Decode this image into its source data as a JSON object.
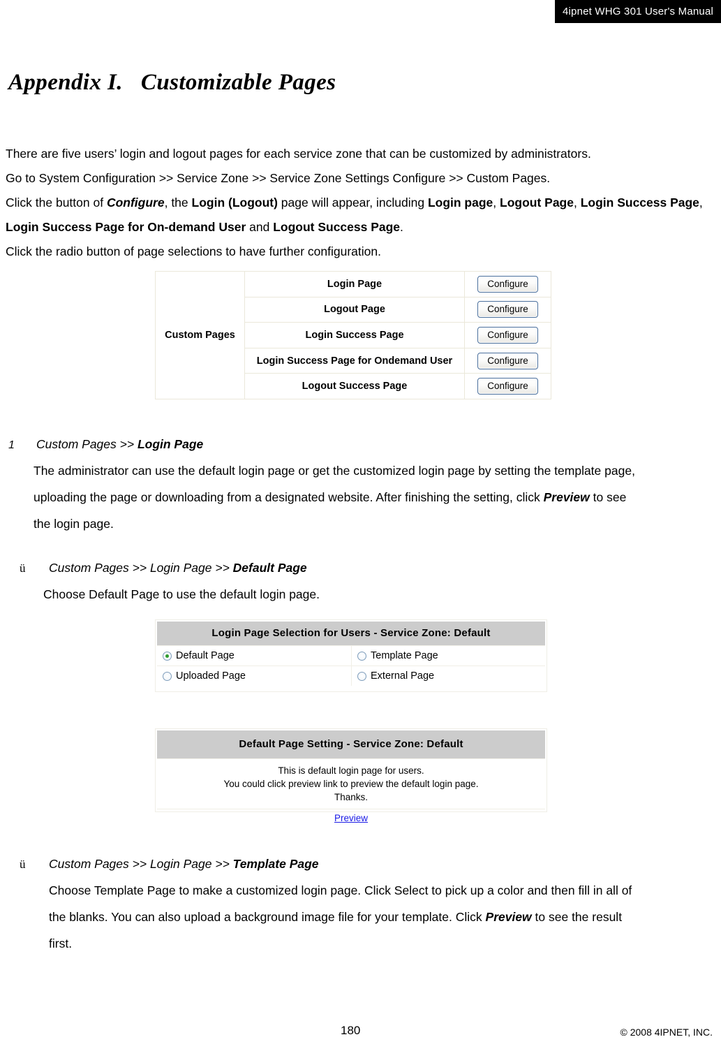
{
  "header": {
    "banner_title": "4ipnet WHG 301 User's Manual"
  },
  "title": {
    "prefix": "Appendix I.",
    "main": "Customizable Pages"
  },
  "intro": {
    "line1": "There are five users’ login and logout pages for each service zone that can be customized by administrators.",
    "line2": "Go to System Configuration >> Service Zone >> Service Zone Settings Configure >> Custom Pages.",
    "line3_a": "Click the button of ",
    "line3_b": "Configure",
    "line3_c": ", the ",
    "line3_d": "Login (Logout)",
    "line3_e": " page will appear, including ",
    "line3_f": "Login page",
    "line3_g": ", ",
    "line3_h": "Logout Page",
    "line3_i": ", ",
    "line3_j": "Login Success Page",
    "line3_k": ", ",
    "line3_l": "Login Success Page for On-demand User",
    "line3_m": " and ",
    "line3_n": "Logout Success Page",
    "line3_o": ".",
    "line4": "Click the radio button of page selections to have further configuration."
  },
  "custom_pages_table": {
    "row_label": "Custom Pages",
    "rows": [
      {
        "name": "Login Page",
        "button": "Configure"
      },
      {
        "name": "Logout Page",
        "button": "Configure"
      },
      {
        "name": "Login Success Page",
        "button": "Configure"
      },
      {
        "name": "Login Success Page for Ondemand User",
        "button": "Configure"
      },
      {
        "name": "Logout Success Page",
        "button": "Configure"
      }
    ]
  },
  "section1": {
    "number": "1",
    "head_italic": "Custom Pages >> ",
    "head_bold": "Login Page",
    "body_line1": "The administrator can use the default login page or get the customized login page by setting the template page,",
    "body_line2_a": "uploading the page or downloading from a designated website. After finishing the setting, click ",
    "body_line2_b": "Preview",
    "body_line2_c": " to see",
    "body_line3": "the login page."
  },
  "section_default": {
    "bullet": "ü",
    "head_italic": "Custom Pages >> Login Page >> ",
    "head_bold": "Default Page",
    "body": "Choose Default Page to use the default login page."
  },
  "selection_table": {
    "header": "Login Page Selection for Users - Service Zone: Default",
    "options": [
      {
        "label": "Default Page",
        "selected": true
      },
      {
        "label": "Template Page",
        "selected": false
      },
      {
        "label": "Uploaded Page",
        "selected": false
      },
      {
        "label": "External Page",
        "selected": false
      }
    ]
  },
  "setting_table": {
    "header": "Default Page Setting - Service Zone: Default",
    "body_line1": "This is default login page for users.",
    "body_line2": "You could click preview link to preview the default login page.",
    "body_line3": "Thanks.",
    "preview_link": "Preview"
  },
  "section_template": {
    "bullet": "ü",
    "head_italic": "Custom Pages >> Login Page >> ",
    "head_bold": "Template Page",
    "body_line1": "Choose Template Page to make a customized login page. Click Select to pick up a color and then fill in all of",
    "body_line2_a": "the blanks. You can also upload a background image file for your template. Click ",
    "body_line2_b": "Preview",
    "body_line2_c": " to see the result",
    "body_line3": "first."
  },
  "footer": {
    "page_number": "180",
    "copyright": "© 2008 4IPNET, INC."
  },
  "colors": {
    "banner_background": "#000000",
    "banner_text": "#ffffff",
    "table_border": "#ebe8da",
    "panel_header": "#cccccc",
    "button_border": "#4a6f9c",
    "link": "#1a1ae6",
    "radio_dot": "#2e9b2e"
  }
}
